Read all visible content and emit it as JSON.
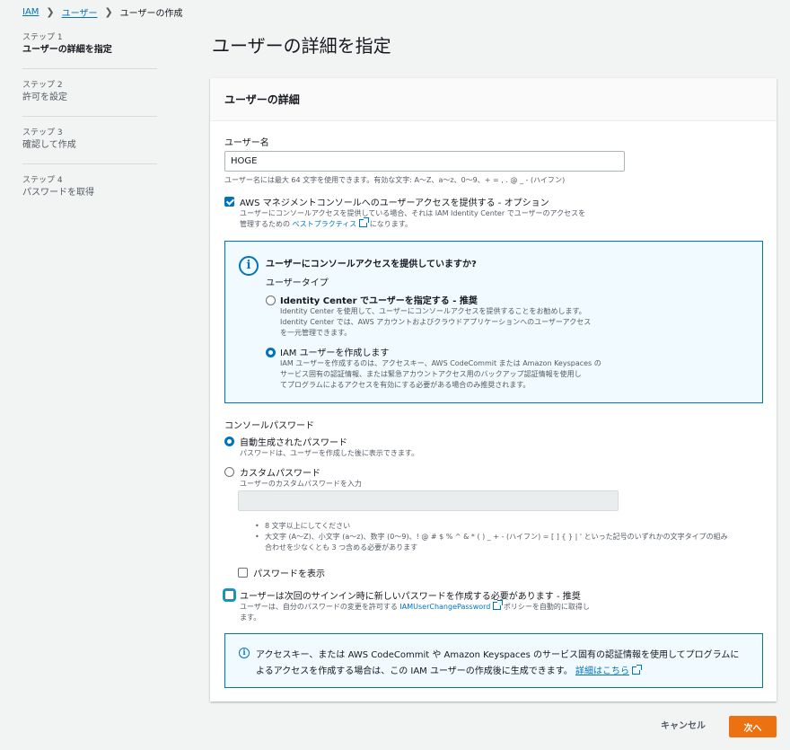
{
  "breadcrumb": {
    "items": [
      "IAM",
      "ユーザー",
      "ユーザーの作成"
    ]
  },
  "steps": [
    {
      "num": "ステップ 1",
      "name": "ユーザーの詳細を指定"
    },
    {
      "num": "ステップ 2",
      "name": "許可を設定"
    },
    {
      "num": "ステップ 3",
      "name": "確認して作成"
    },
    {
      "num": "ステップ 4",
      "name": "パスワードを取得"
    }
  ],
  "page_title": "ユーザーの詳細を指定",
  "panel": {
    "title": "ユーザーの詳細",
    "username_label": "ユーザー名",
    "username_value": "HOGE",
    "username_hint": "ユーザー名には最大 64 文字を使用できます。有効な文字: A～Z、a～z、0～9、+ = , . @ _ - (ハイフン)",
    "console_access": {
      "label": "AWS マネジメントコンソールへのユーザーアクセスを提供する - オプション",
      "desc_line1": "ユーザーにコンソールアクセスを提供している場合、それは IAM Identity Center でユーザーのアクセスを",
      "desc_line2_pre": "管理するための",
      "desc_link": "ベストプラクティス",
      "desc_line2_post": "になります。"
    },
    "info_box": {
      "question": "ユーザーにコンソールアクセスを提供していますか?",
      "user_type_label": "ユーザータイプ",
      "option1_label": "Identity Center でユーザーを指定する - 推奨",
      "option1_desc1": "Identity Center を使用して、ユーザーにコンソールアクセスを提供することをお勧めします。",
      "option1_desc2": "Identity Center では、AWS アカウントおよびクラウドアプリケーションへのユーザーアクセス",
      "option1_desc3": "を一元管理できます。",
      "option2_label": "IAM ユーザーを作成します",
      "option2_desc1": "IAM ユーザーを作成するのは、アクセスキー、AWS CodeCommit または Amazon Keyspaces の",
      "option2_desc2": "サービス固有の認証情報、または緊急アカウントアクセス用のバックアップ認証情報を使用し",
      "option2_desc3": "てプログラムによるアクセスを有効にする必要がある場合のみ推奨されます。"
    },
    "password": {
      "section_label": "コンソールパスワード",
      "auto_label": "自動生成されたパスワード",
      "auto_desc": "パスワードは、ユーザーを作成した後に表示できます。",
      "custom_label": "カスタムパスワード",
      "custom_desc": "ユーザーのカスタムパスワードを入力",
      "req1": "8 文字以上にしてください",
      "req2_line1": "大文字 (A～Z)、小文字 (a～z)、数字 (0～9)、! @ # $ % ^ & * ( ) _ + - (ハイフン) = [ ] { } | ' といった記号のいずれかの文字タイプの組み",
      "req2_line2": "合わせを少なくとも 3 つ含める必要があります",
      "show_password_label": "パスワードを表示"
    },
    "reset_required": {
      "label": "ユーザーは次回のサインイン時に新しいパスワードを作成する必要があります - 推奨",
      "desc_pre": "ユーザーは、自分のパスワードの変更を許可する",
      "desc_link": "IAMUserChangePassword",
      "desc_post": "ポリシーを自動的に取得し",
      "desc_line2": "ます。"
    },
    "bottom_info": {
      "line1": "アクセスキー、または AWS CodeCommit や Amazon Keyspaces のサービス固有の認証情報を使用してプログラムに",
      "line2_pre": "よるアクセスを作成する場合は、この IAM ユーザーの作成後に生成できます。",
      "link": "詳細はこちら"
    }
  },
  "buttons": {
    "cancel": "キャンセル",
    "next": "次へ"
  },
  "colors": {
    "primary": "#ec7211",
    "link": "#0073bb",
    "info_bg": "#f1faff"
  }
}
